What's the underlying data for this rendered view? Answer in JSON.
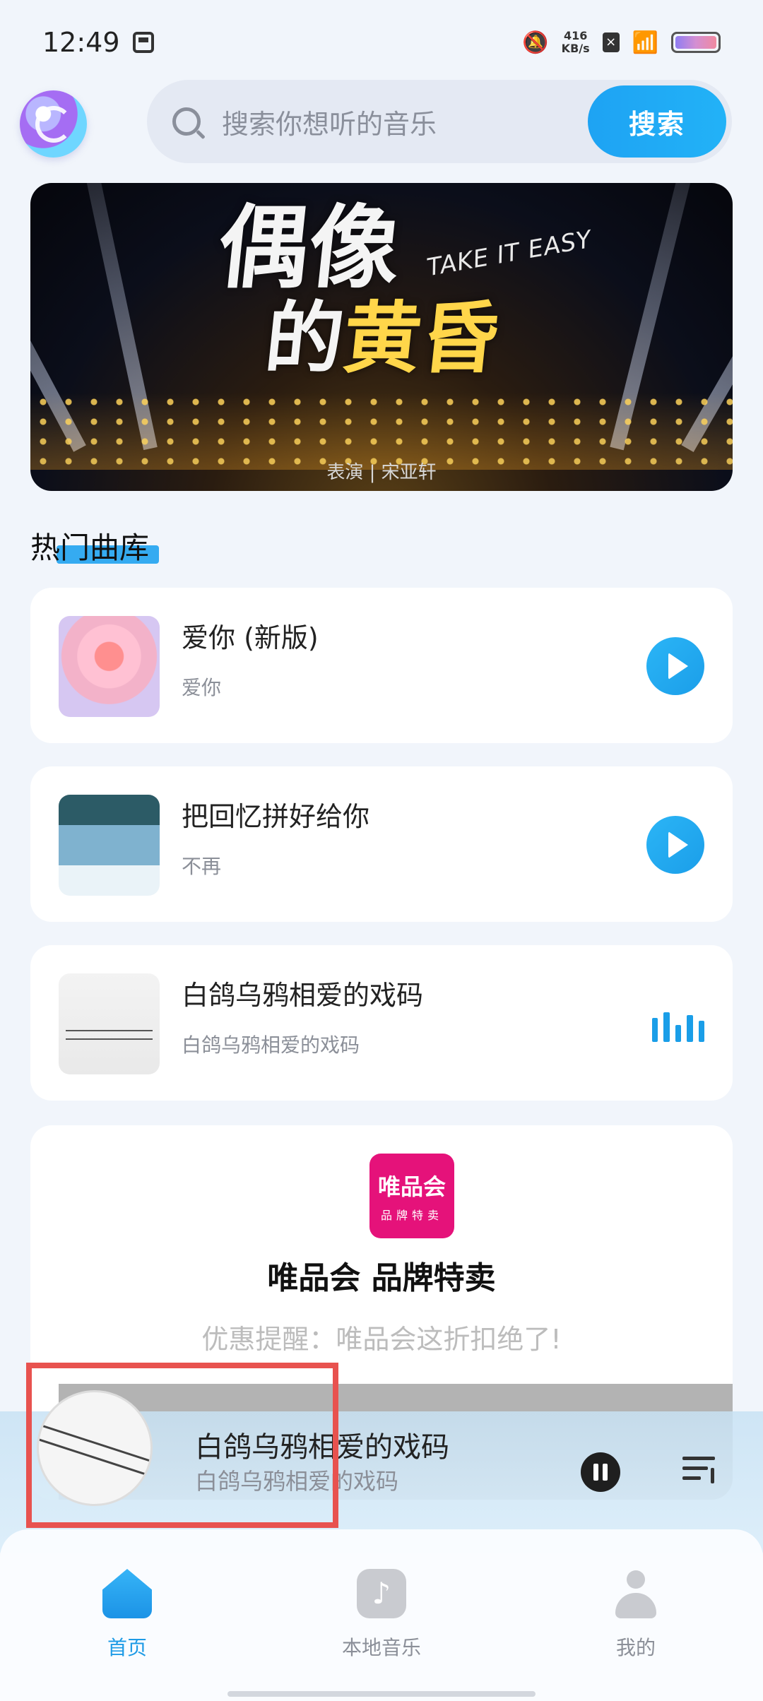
{
  "status_bar": {
    "time": "12:49",
    "net_speed_value": "416",
    "net_speed_unit": "KB/s"
  },
  "header": {
    "search_placeholder": "搜索你想听的音乐",
    "search_button": "搜索"
  },
  "banner": {
    "title_line1": "偶像",
    "title_line2a": "的",
    "title_line2b": "黄昏",
    "subtitle": "TAKE IT EASY",
    "credit": "表演 | 宋亚轩"
  },
  "section": {
    "title": "热门曲库"
  },
  "songs": [
    {
      "title": "爱你 (新版)",
      "artist": "爱你",
      "state": "play"
    },
    {
      "title": "把回忆拼好给你",
      "artist": "不再",
      "state": "play"
    },
    {
      "title": "白鸽乌鸦相爱的戏码",
      "artist": "白鸽乌鸦相爱的戏码",
      "state": "playing"
    }
  ],
  "ad": {
    "logo_big": "唯品会",
    "logo_small": "品牌特卖",
    "title": "唯品会 品牌特卖",
    "subtitle": "优惠提醒：唯品会这折扣绝了!"
  },
  "now_playing": {
    "title": "白鸽乌鸦相爱的戏码",
    "artist": "白鸽乌鸦相爱的戏码"
  },
  "bottom_nav": [
    {
      "label": "首页",
      "active": true
    },
    {
      "label": "本地音乐",
      "active": false
    },
    {
      "label": "我的",
      "active": false
    }
  ],
  "colors": {
    "accent": "#1e9be6",
    "highlight": "#e8524f"
  }
}
